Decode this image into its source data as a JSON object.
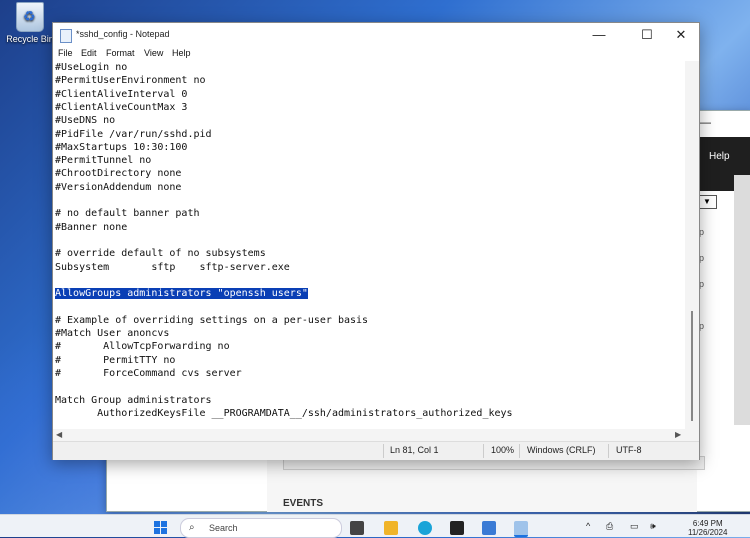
{
  "desktop": {
    "recycle_bin_label": "Recycle Bin"
  },
  "background_window": {
    "help_label": "Help",
    "events_label": "EVENTS",
    "minimize_glyph": "—",
    "snippets": [
      "p",
      "",
      "p",
      "p",
      "",
      "p"
    ]
  },
  "notepad": {
    "title": "*sshd_config - Notepad",
    "menu": [
      "File",
      "Edit",
      "Format",
      "View",
      "Help"
    ],
    "lines": [
      "#UseLogin no",
      "#PermitUserEnvironment no",
      "#ClientAliveInterval 0",
      "#ClientAliveCountMax 3",
      "#UseDNS no",
      "#PidFile /var/run/sshd.pid",
      "#MaxStartups 10:30:100",
      "#PermitTunnel no",
      "#ChrootDirectory none",
      "#VersionAddendum none",
      "",
      "# no default banner path",
      "#Banner none",
      "",
      "# override default of no subsystems",
      "Subsystem       sftp    sftp-server.exe",
      "",
      "AllowGroups administrators \"openssh users\"",
      "",
      "# Example of overriding settings on a per-user basis",
      "#Match User anoncvs",
      "#       AllowTcpForwarding no",
      "#       PermitTTY no",
      "#       ForceCommand cvs server",
      "",
      "Match Group administrators",
      "       AuthorizedKeysFile __PROGRAMDATA__/ssh/administrators_authorized_keys"
    ],
    "selected_line_index": 17,
    "status": {
      "position": "Ln 81, Col 1",
      "zoom": "100%",
      "line_ending": "Windows (CRLF)",
      "encoding": "UTF-8"
    }
  },
  "taskbar": {
    "search_placeholder": "Search",
    "time": "6:49 PM",
    "date": "11/26/2024"
  }
}
